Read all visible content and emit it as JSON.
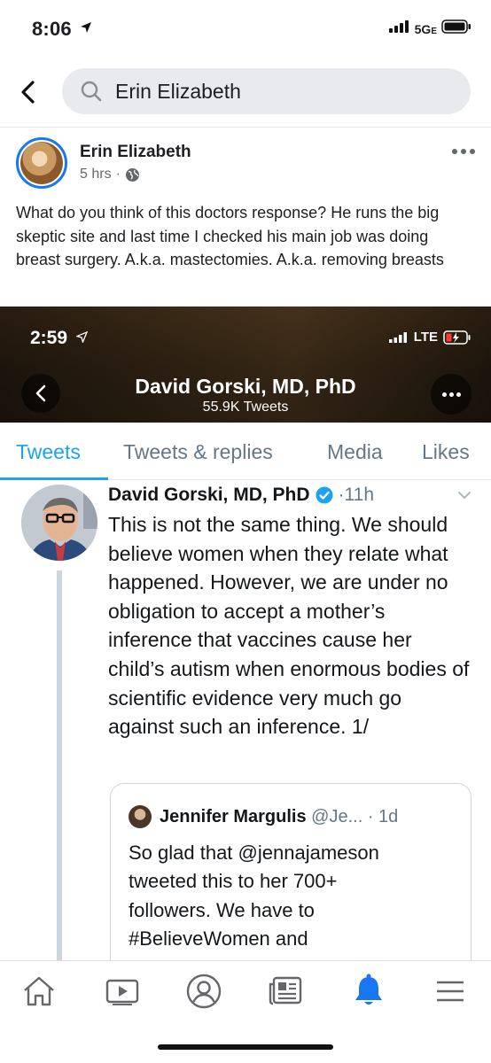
{
  "status_bar": {
    "time": "8:06",
    "network": "5G",
    "network_suffix": "E"
  },
  "search": {
    "query": "Erin Elizabeth",
    "back_icon": "chevron-left-icon",
    "search_icon": "magnifier-icon"
  },
  "post": {
    "author": "Erin Elizabeth",
    "time": "5 hrs",
    "separator": "·",
    "audience_icon": "globe-icon",
    "text": "What do you think of this doctors response? He runs the big skeptic site and last time I checked his main job was doing breast surgery. A.k.a. mastectomies. A.k.a. removing breasts",
    "more_icon": "ellipsis-icon"
  },
  "tweet_screenshot": {
    "status_time": "2:59",
    "status_network": "LTE",
    "profile_name": "David Gorski, MD, PhD",
    "tweet_count": "55.9K Tweets",
    "tabs": [
      {
        "label": "Tweets",
        "active": true
      },
      {
        "label": "Tweets & replies",
        "active": false
      },
      {
        "label": "Media",
        "active": false
      },
      {
        "label": "Likes",
        "active": false
      }
    ],
    "tweet": {
      "author": "David Gorski, MD, PhD",
      "verified": true,
      "time": "·11h",
      "text": "This is not the same thing. We should believe women when they relate what happened. However, we are under no obligation to accept a mother’s inference that vaccines cause her child’s autism when enormous bodies of scientific evidence very much go against such an inference. 1/"
    },
    "quoted": {
      "author": "Jennifer Margulis",
      "handle": "@Je...",
      "time": "· 1d",
      "text_line1": "So glad that @jennajameson",
      "text_line2": "tweeted this to her 700+",
      "text_line3": "followers. We have to",
      "text_line4": "#BelieveWomen and"
    }
  },
  "bottom_nav": {
    "items": [
      {
        "icon": "home-icon",
        "active": false
      },
      {
        "icon": "watch-video-icon",
        "active": false
      },
      {
        "icon": "profile-icon",
        "active": false
      },
      {
        "icon": "news-feed-icon",
        "active": false
      },
      {
        "icon": "notifications-bell-icon",
        "active": true
      },
      {
        "icon": "menu-icon",
        "active": false
      }
    ]
  },
  "colors": {
    "fb_blue": "#1877f2",
    "twitter_blue": "#1da1f2",
    "text_secondary": "#65676b"
  }
}
